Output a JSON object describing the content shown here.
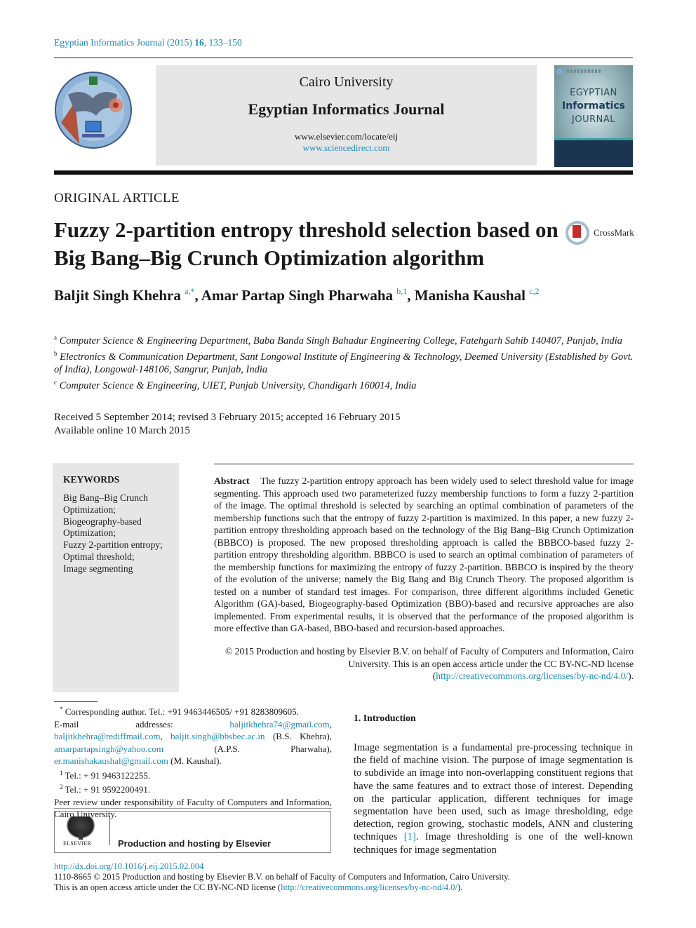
{
  "header": {
    "journal_ref_prefix": "Egyptian Informatics Journal (2015) ",
    "journal_ref_volume": "16",
    "journal_ref_pages": ", 133–150",
    "masthead": {
      "university": "Cairo University",
      "journal_name": "Egyptian Informatics Journal",
      "url_elsevier": "www.elsevier.com/locate/eij",
      "url_sciencedirect": "www.sciencedirect.com"
    },
    "cover": {
      "line1": "EGYPTIAN",
      "line2": "Informatics",
      "line3": "JOURNAL"
    },
    "left_logo": "faculty-of-computers-and-information-logo"
  },
  "article": {
    "type": "ORIGINAL ARTICLE",
    "title": "Fuzzy 2-partition entropy threshold selection based on Big Bang–Big Crunch Optimization algorithm",
    "crossmark_label": "CrossMark",
    "authors": [
      {
        "name": "Baljit Singh Khehra",
        "marks": "a,*"
      },
      {
        "name": "Amar Partap Singh Pharwaha",
        "marks": "b,1"
      },
      {
        "name": "Manisha Kaushal",
        "marks": "c,2"
      }
    ],
    "affiliations": [
      {
        "mark": "a",
        "text": "Computer Science & Engineering Department, Baba Banda Singh Bahadur Engineering College, Fatehgarh Sahib 140407, Punjab, India"
      },
      {
        "mark": "b",
        "text": "Electronics & Communication Department, Sant Longowal Institute of Engineering & Technology, Deemed University (Established by Govt. of India), Longowal-148106, Sangrur, Punjab, India"
      },
      {
        "mark": "c",
        "text": "Computer Science & Engineering, UIET, Punjab University, Chandigarh 160014, India"
      }
    ],
    "dates": {
      "history": "Received 5 September 2014; revised 3 February 2015; accepted 16 February 2015",
      "online": "Available online 10 March 2015"
    }
  },
  "keywords": {
    "heading": "KEYWORDS",
    "items": [
      "Big Bang–Big Crunch Optimization;",
      "Biogeography-based Optimization;",
      "Fuzzy 2-partition entropy;",
      "Optimal threshold;",
      "Image segmenting"
    ]
  },
  "abstract": {
    "label": "Abstract",
    "text": "The fuzzy 2-partition entropy approach has been widely used to select threshold value for image segmenting. This approach used two parameterized fuzzy membership functions to form a fuzzy 2-partition of the image. The optimal threshold is selected by searching an optimal combination of parameters of the membership functions such that the entropy of fuzzy 2-partition is maximized. In this paper, a new fuzzy 2-partition entropy thresholding approach based on the technology of the Big Bang–Big Crunch Optimization (BBBCO) is proposed. The new proposed thresholding approach is called the BBBCO-based fuzzy 2-partition entropy thresholding algorithm. BBBCO is used to search an optimal combination of parameters of the membership functions for maximizing the entropy of fuzzy 2-partition. BBBCO is inspired by the theory of the evolution of the universe; namely the Big Bang and Big Crunch Theory. The proposed algorithm is tested on a number of standard test images. For comparison, three different algorithms included Genetic Algorithm (GA)-based, Biogeography-based Optimization (BBO)-based and recursive approaches are also implemented. From experimental results, it is observed that the performance of the proposed algorithm is more effective than GA-based, BBO-based and recursion-based approaches.",
    "copyright_text": "© 2015 Production and hosting by Elsevier B.V. on behalf of Faculty of Computers and Information, Cairo University. This is an open access article under the CC BY-NC-ND license (",
    "license_link": "http://creativecommons.org/licenses/by-nc-nd/4.0/",
    "copyright_close": ")."
  },
  "footnotes": {
    "corresponding": "Corresponding author. Tel.: +91 9463446505/ +91 8283809605.",
    "email_label": "E-mail addresses: ",
    "emails": [
      {
        "address": "baljitkhehra74@gmail.com",
        "owner": ""
      },
      {
        "address": "baljitkhehra@rediffmail.com",
        "owner": ""
      },
      {
        "address": "baljit.singh@bbsbec.ac.in",
        "owner": "(B.S. Khehra)"
      },
      {
        "address": "amarpartapsingh@yahoo.com",
        "owner": "(A.P.S. Pharwaha)"
      },
      {
        "address": "er.manishakaushal@gmail.com",
        "owner": "(M. Kaushal)."
      }
    ],
    "tel1_mark": "1",
    "tel1": "Tel.: + 91 9463122255.",
    "tel2_mark": "2",
    "tel2": "Tel.: + 91 9592200491.",
    "peer_review": "Peer review under responsibility of Faculty of Computers and Information, Cairo University.",
    "elsevier_wordmark": "ELSEVIER",
    "production": "Production and hosting by Elsevier"
  },
  "introduction": {
    "heading": "1. Introduction",
    "text_before_ref": "Image segmentation is a fundamental pre-processing technique in the field of machine vision. The purpose of image segmentation is to subdivide an image into non-overlapping constituent regions that have the same features and to extract those of interest. Depending on the particular application, different techniques for image segmentation have been used, such as image thresholding, edge detection, region growing, stochastic models, ANN and clustering techniques ",
    "ref": "[1]",
    "text_after_ref": ". Image thresholding is one of the well-known techniques for image segmentation"
  },
  "page_footer": {
    "doi": "http://dx.doi.org/10.1016/j.eij.2015.02.004",
    "issn_line": "1110-8665 © 2015 Production and hosting by Elsevier B.V. on behalf of Faculty of Computers and Information, Cairo University.",
    "oa_prefix": "This is an open access article under the CC BY-NC-ND license (",
    "oa_link": "http://creativecommons.org/licenses/by-nc-nd/4.0/",
    "oa_suffix": ")."
  },
  "colors": {
    "link": "#1e8bb8",
    "masthead_bg": "#e6e6e6",
    "keywords_bg": "#e6e6e6",
    "text": "#1a1a1a"
  }
}
